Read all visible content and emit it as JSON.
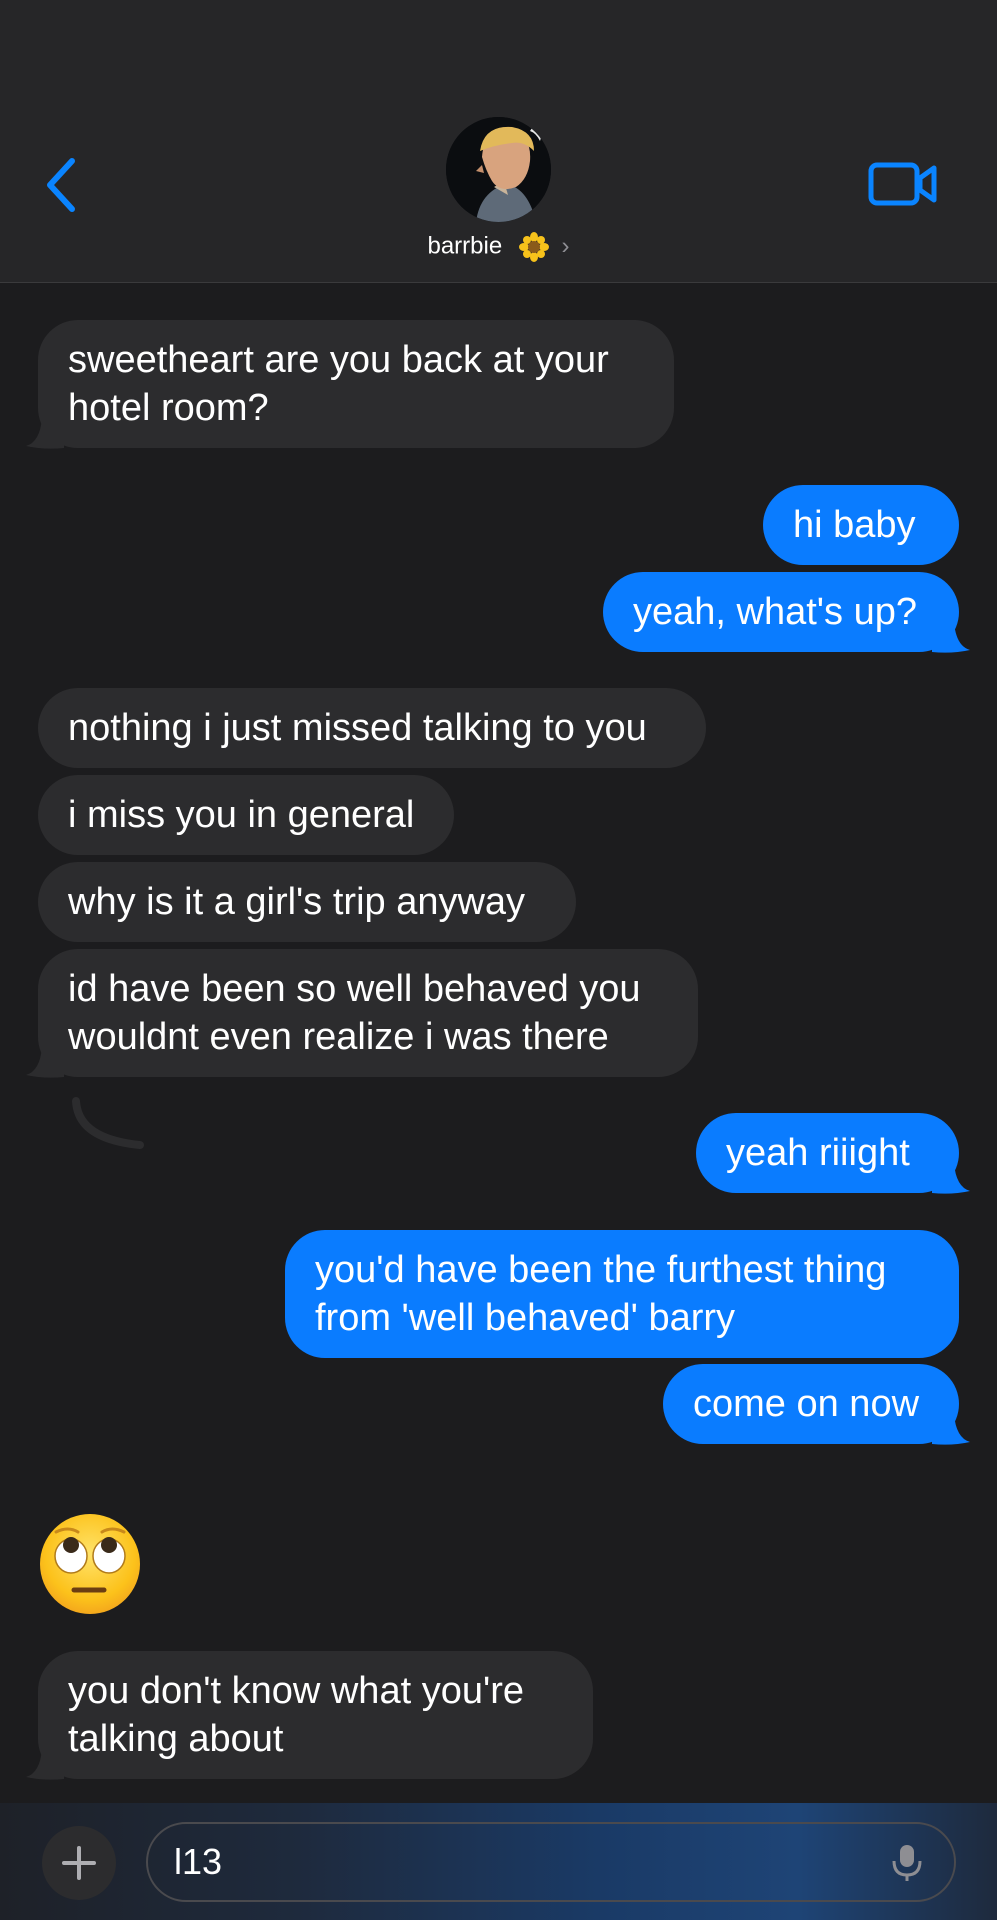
{
  "header": {
    "contact_name": "barrbie",
    "chevron": "›",
    "icons": {
      "back": "chevron-left-icon",
      "video": "video-camera-icon",
      "flower": "sunflower-emoji"
    }
  },
  "colors": {
    "background": "#1c1c1e",
    "header_bg": "#262628",
    "incoming_bubble": "#2c2c2e",
    "outgoing_bubble": "#0a7cff",
    "accent": "#0a84ff"
  },
  "messages": [
    {
      "from": "them",
      "lines": [
        "sweetheart are you back at your",
        "hotel room?"
      ]
    },
    {
      "from": "me",
      "lines": [
        "hi baby"
      ]
    },
    {
      "from": "me",
      "lines": [
        "yeah, what's up?"
      ]
    },
    {
      "from": "them",
      "lines": [
        "nothing i just missed talking to you"
      ]
    },
    {
      "from": "them",
      "lines": [
        "i miss you in general"
      ]
    },
    {
      "from": "them",
      "lines": [
        "why is it a girl's trip anyway"
      ]
    },
    {
      "from": "them",
      "lines": [
        "id have been so well behaved you",
        "wouldnt even realize i was there"
      ]
    },
    {
      "from": "me",
      "lines": [
        "yeah riiight"
      ]
    },
    {
      "from": "me",
      "lines": [
        "you'd have been the furthest thing",
        "from 'well behaved' barry"
      ]
    },
    {
      "from": "me",
      "lines": [
        "come on now"
      ]
    },
    {
      "from": "them",
      "emoji": "face-with-rolling-eyes"
    },
    {
      "from": "them",
      "lines": [
        "you don't know what you're",
        "talking about"
      ]
    }
  ],
  "composer": {
    "placeholder": "",
    "value": "l13",
    "icons": {
      "add": "plus-icon",
      "mic": "microphone-icon"
    }
  }
}
